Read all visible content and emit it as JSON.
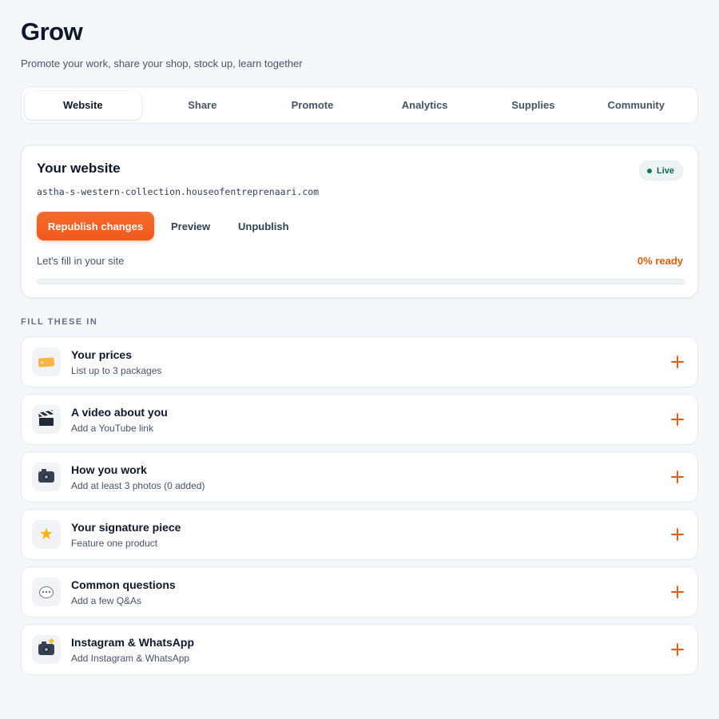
{
  "header": {
    "title": "Grow",
    "subtitle": "Promote your work, share your shop, stock up, learn together"
  },
  "tabs": [
    {
      "label": "Website",
      "active": true
    },
    {
      "label": "Share",
      "active": false
    },
    {
      "label": "Promote",
      "active": false
    },
    {
      "label": "Analytics",
      "active": false
    },
    {
      "label": "Supplies",
      "active": false
    },
    {
      "label": "Community",
      "active": false
    }
  ],
  "website_card": {
    "title": "Your website",
    "status": "Live",
    "url": "astha-s-western-collection.houseofentreprenaari.com",
    "primary_button": "Republish changes",
    "preview_button": "Preview",
    "unpublish_button": "Unpublish",
    "progress_label": "Let's fill in your site",
    "progress_text": "0% ready",
    "progress_value": 0
  },
  "section_label": "FILL THESE IN",
  "tasks": [
    {
      "title": "Your prices",
      "subtitle": "List up to 3 packages",
      "icon": "price-tag-icon"
    },
    {
      "title": "A video about you",
      "subtitle": "Add a YouTube link",
      "icon": "clapperboard-icon"
    },
    {
      "title": "How you work",
      "subtitle": "Add at least 3 photos (0 added)",
      "icon": "camera-icon"
    },
    {
      "title": "Your signature piece",
      "subtitle": "Feature one product",
      "icon": "star-icon"
    },
    {
      "title": "Common questions",
      "subtitle": "Add a few Q&As",
      "icon": "speech-bubble-icon"
    },
    {
      "title": "Instagram & WhatsApp",
      "subtitle": "Add Instagram & WhatsApp",
      "icon": "camera-flash-icon"
    }
  ],
  "colors": {
    "accent": "#ef5a1e",
    "live_text": "#0b6b4e",
    "background": "#f6f7fa"
  }
}
